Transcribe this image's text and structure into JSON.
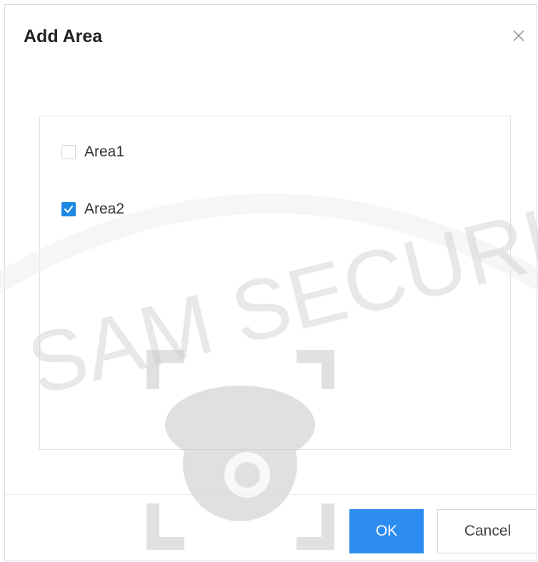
{
  "dialog": {
    "title": "Add Area",
    "close_icon": "close-icon"
  },
  "areas": [
    {
      "label": "Area1",
      "checked": false
    },
    {
      "label": "Area2",
      "checked": true
    }
  ],
  "buttons": {
    "ok_label": "OK",
    "cancel_label": "Cancel"
  },
  "watermark": {
    "text": "SAM SECURI",
    "icon": "dome-camera-icon"
  },
  "colors": {
    "accent": "#2d8cf0",
    "checkbox_checked": "#1e88e5"
  }
}
